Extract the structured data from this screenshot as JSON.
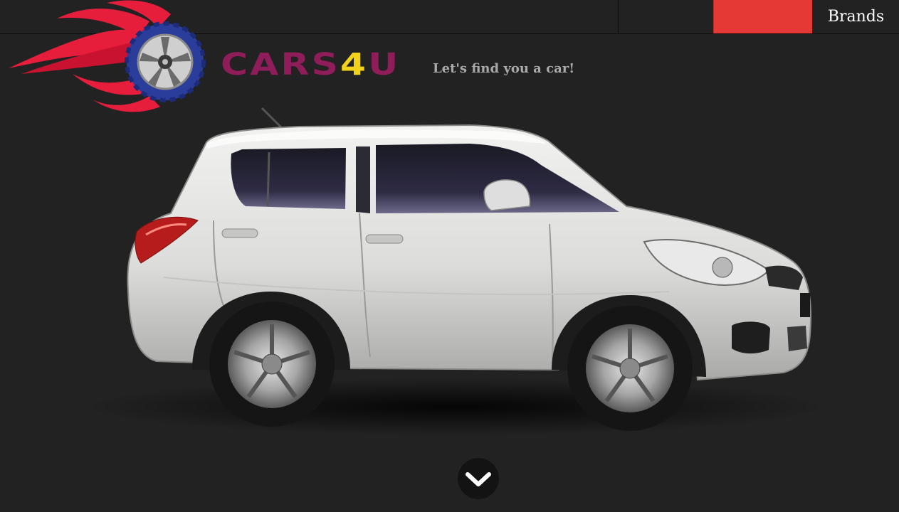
{
  "nav": {
    "items": [
      {
        "label": ""
      },
      {
        "label": ""
      },
      {
        "label": "Brands"
      }
    ],
    "active_index": 1
  },
  "brand": {
    "name_part1": "CARS",
    "name_part2": "4",
    "name_part3": "U",
    "tagline": "Let's find you a car!"
  },
  "hero": {
    "image": "white-hatchback-car"
  },
  "scroll": {
    "icon": "chevron-down-icon"
  },
  "colors": {
    "background": "#222222",
    "accent": "#e53935",
    "brand_primary": "#8e1d5a",
    "brand_secondary": "#f3d21b",
    "wheel_blue": "#2a3d9a",
    "flame_red": "#e61e3c"
  }
}
